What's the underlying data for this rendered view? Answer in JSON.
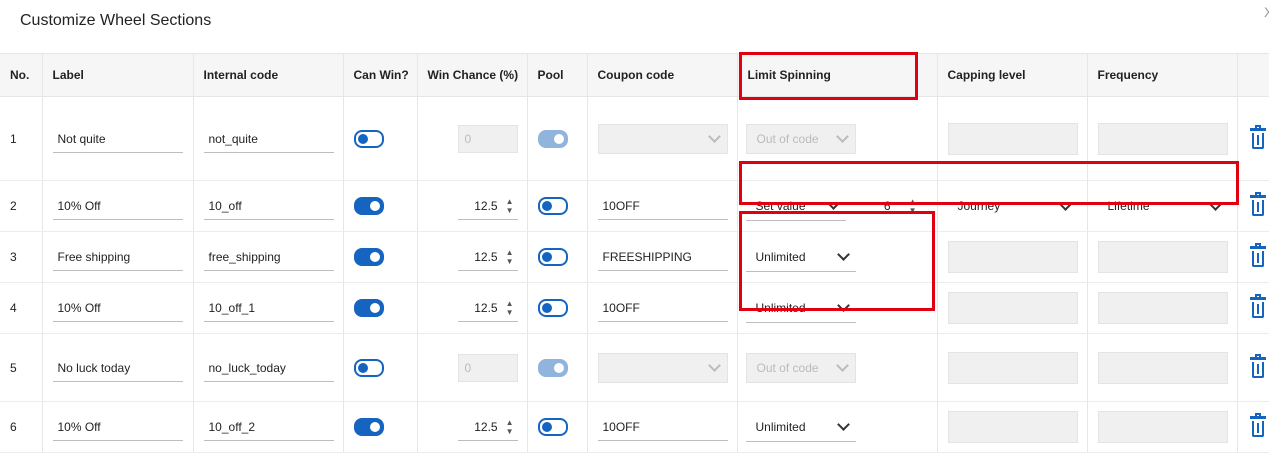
{
  "dialog": {
    "title": "Customize Wheel Sections",
    "close_glyph": "X"
  },
  "columns": [
    "No.",
    "Label",
    "Internal code",
    "Can Win?",
    "Win Chance (%)",
    "Pool",
    "Coupon code",
    "Limit Spinning",
    "Capping level",
    "Frequency",
    ""
  ],
  "rows": [
    {
      "no": "1",
      "label": "Not quite",
      "code": "not_quite",
      "can_win": false,
      "win_chance": "0",
      "win_disabled": true,
      "pool": "disabled",
      "coupon": "",
      "coupon_disabled": true,
      "limit": "Out of code",
      "limit_disabled": true
    },
    {
      "no": "2",
      "label": "10% Off",
      "code": "10_off",
      "can_win": true,
      "win_chance": "12.5",
      "pool": "off",
      "coupon": "10OFF",
      "limit": "Set value",
      "limit_value": "6",
      "capping": "Journey",
      "frequency": "Lifetime"
    },
    {
      "no": "3",
      "label": "Free shipping",
      "code": "free_shipping",
      "can_win": true,
      "win_chance": "12.5",
      "pool": "off",
      "coupon": "FREESHIPPING",
      "limit": "Unlimited"
    },
    {
      "no": "4",
      "label": "10% Off",
      "code": "10_off_1",
      "can_win": true,
      "win_chance": "12.5",
      "pool": "off",
      "coupon": "10OFF",
      "limit": "Unlimited"
    },
    {
      "no": "5",
      "label": "No luck today",
      "code": "no_luck_today",
      "can_win": false,
      "win_chance": "0",
      "win_disabled": true,
      "pool": "disabled",
      "coupon": "",
      "coupon_disabled": true,
      "limit": "Out of code",
      "limit_disabled": true
    },
    {
      "no": "6",
      "label": "10% Off",
      "code": "10_off_2",
      "can_win": true,
      "win_chance": "12.5",
      "pool": "off",
      "coupon": "10OFF",
      "limit": "Unlimited"
    }
  ],
  "colors": {
    "accent": "#1565c0",
    "highlight": "#e0000f",
    "disabled_bg": "#f0f0f0"
  },
  "icons": {
    "delete": "trash-icon",
    "dropdown": "chevron-down-icon",
    "stepper": "stepper-arrows-icon"
  }
}
